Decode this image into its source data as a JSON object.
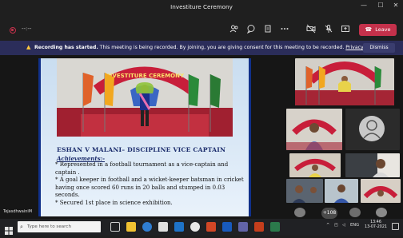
{
  "window": {
    "title": "Investiture Ceremony",
    "minimize": "—",
    "maximize": "☐",
    "close": "✕"
  },
  "toolbar": {
    "timer": "--:--",
    "leave_label": "Leave",
    "tools": [
      "people-icon",
      "chat-icon",
      "reactions-icon",
      "more-icon",
      "camera-off-icon",
      "mic-off-icon",
      "share-icon"
    ]
  },
  "banner": {
    "title": "Recording has started.",
    "message": " This meeting is being recorded. By joining, you are giving consent for this meeting to be recorded. ",
    "link": "Privacy policy",
    "dismiss_label": "Dismiss"
  },
  "slide": {
    "name": "ESHAN V MALANI– DISCIPLINE VICE CAPTAIN",
    "heading": "Achievements:-",
    "items": [
      "* Represented in a football tournament as a vice-captain and captain .",
      "* A goal keeper in football and a wicket-keeper batsman in cricket having once scored 60 runs in 20 balls and stumped in 0.03 seconds.",
      "* Secured 1st place in science exhibition."
    ],
    "banner_text": "INVESTITURE CEREMONY"
  },
  "presenter": {
    "name": "TejasdhwainiM"
  },
  "participants": {
    "more_count": "+108"
  },
  "taskbar": {
    "search_placeholder": "Type here to search",
    "language": "ENG",
    "time": "13:46",
    "date": "13-07-2021"
  },
  "colors": {
    "leave": "#c4314b",
    "banner": "#2b2d5a",
    "slide_border": "#10308a",
    "slide_title": "#1a2b6b"
  }
}
